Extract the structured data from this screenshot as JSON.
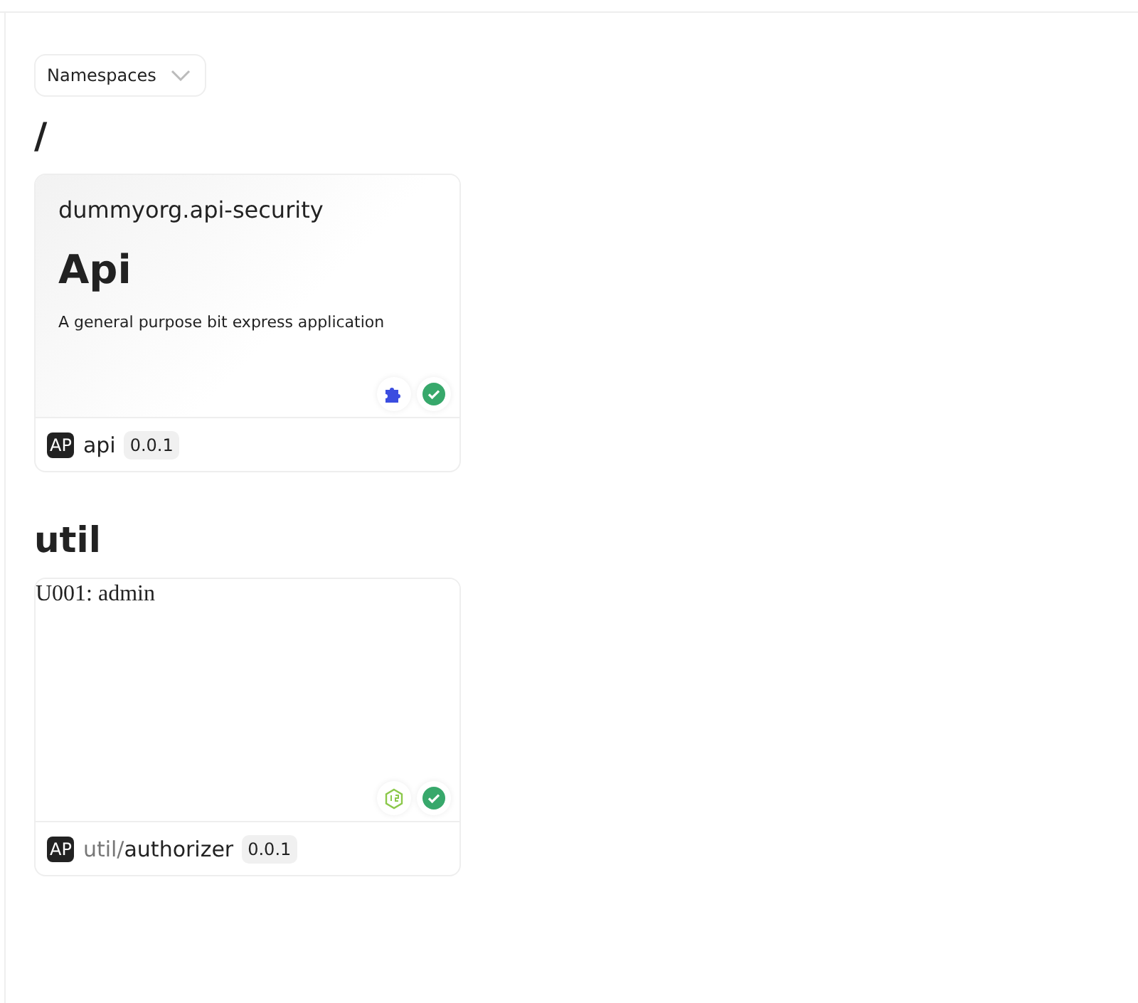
{
  "namespace_dropdown": {
    "label": "Namespaces"
  },
  "groups": [
    {
      "heading": "/",
      "cards": [
        {
          "kind": "preview",
          "scope": "dummyorg.api-security",
          "title": "Api",
          "description": "A general purpose bit express application",
          "env": {
            "kind": "puzzle"
          },
          "build_ok": true,
          "owner": "AP",
          "name": "api",
          "version": "0.0.1"
        }
      ]
    },
    {
      "heading": "util",
      "cards": [
        {
          "kind": "raw",
          "text": "U001: admin",
          "env": {
            "kind": "nodejs"
          },
          "build_ok": true,
          "owner": "AP",
          "name_prefix": "util/",
          "name": "authorizer",
          "version": "0.0.1"
        }
      ]
    }
  ]
}
